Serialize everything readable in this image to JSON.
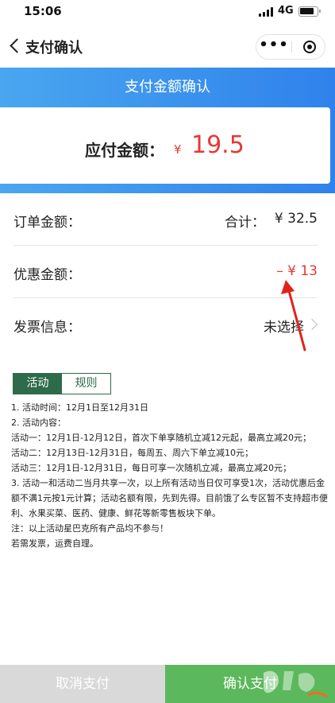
{
  "status_bar": {
    "time": "15:06",
    "network": "4G"
  },
  "nav": {
    "title": "支付确认",
    "more_glyph": "•••"
  },
  "header": {
    "title": "支付金额确认"
  },
  "payable": {
    "label": "应付金额：",
    "currency": "¥",
    "value": "19.5"
  },
  "order": {
    "label": "订单金额：",
    "total_label": "合计：",
    "total_value": "¥ 32.5"
  },
  "discount": {
    "label": "优惠金额：",
    "value": "– ¥ 13"
  },
  "invoice": {
    "label": "发票信息：",
    "value": "未选择"
  },
  "tabs": {
    "activity": "活动",
    "rules": "规则"
  },
  "rules": {
    "line1": "1. 活动时间：12月1日至12月31日",
    "line2": "2. 活动内容：",
    "line3": "活动一：12月1日-12月12日，首次下单享随机立减12元起，最高立减20元；",
    "line4": "活动二：12月13日-12月31日，每周五、周六下单立减10元；",
    "line5": "活动三：12月1日-12月31日，每日可享一次随机立减，最高立减20元；",
    "line6": "3. 活动一和活动二当月共享一次，以上所有活动当日仅可享受1次，活动优惠后金额不满1元按1元计算；活动名额有限，先到先得。目前饿了么专区暂不支持超市便利、水果买菜、医药、健康、鲜花等新零售板块下单。",
    "line7": "注：以上活动星巴克所有产品均不参与！",
    "line8": "若需发票，运费自理。"
  },
  "buttons": {
    "cancel": "取消支付",
    "confirm": "确认支付"
  },
  "colors": {
    "accent_blue": "#2f82eb",
    "price_red": "#e53935",
    "tab_green": "#2e6b4a",
    "confirm_green": "#5cb85c"
  }
}
